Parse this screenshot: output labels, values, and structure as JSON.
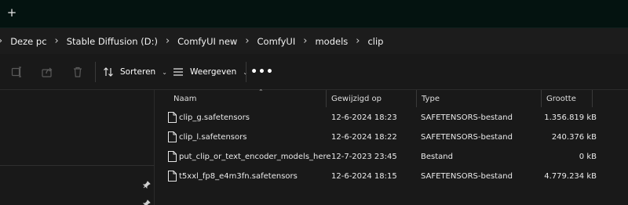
{
  "tabstrip": {
    "new_tab_symbol": "+"
  },
  "address": {
    "crumbs": [
      "Deze pc",
      "Stable Diffusion (D:)",
      "ComfyUI new",
      "ComfyUI",
      "models",
      "clip"
    ],
    "separator": "›"
  },
  "toolbar": {
    "sort_label": "Sorteren",
    "view_label": "Weergeven",
    "more_label": "•••",
    "icons": [
      "rename-icon",
      "share-icon",
      "delete-icon",
      "sort-icon",
      "view-icon",
      "more-icon"
    ]
  },
  "columns": {
    "name": "Naam",
    "modified": "Gewijzigd op",
    "type": "Type",
    "size": "Grootte"
  },
  "files": [
    {
      "name": "clip_g.safetensors",
      "modified": "12-6-2024 18:23",
      "type": "SAFETENSORS-bestand",
      "size": "1.356.819 kB"
    },
    {
      "name": "clip_l.safetensors",
      "modified": "12-6-2024 18:22",
      "type": "SAFETENSORS-bestand",
      "size": "240.376 kB"
    },
    {
      "name": "put_clip_or_text_encoder_models_here",
      "modified": "12-7-2023 23:45",
      "type": "Bestand",
      "size": "0 kB"
    },
    {
      "name": "t5xxl_fp8_e4m3fn.safetensors",
      "modified": "12-6-2024 18:15",
      "type": "SAFETENSORS-bestand",
      "size": "4.779.234 kB"
    }
  ],
  "colors": {
    "background": "#191919",
    "tabstrip": "#041310",
    "text": "#ffffff"
  }
}
